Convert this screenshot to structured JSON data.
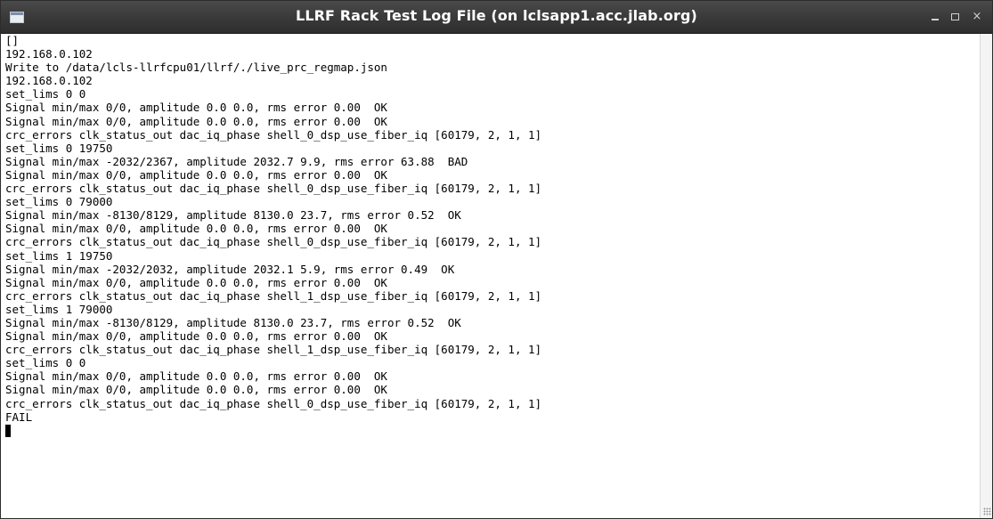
{
  "window": {
    "title": "LLRF Rack Test Log File (on lclsapp1.acc.jlab.org)",
    "icon": "terminal-icon",
    "controls": {
      "minimize": "minimize-icon",
      "maximize": "maximize-icon",
      "close_glyph": "×"
    },
    "colors": {
      "titlebar": "#3a3a3a",
      "title_text": "#ffffff",
      "terminal_bg": "#ffffff",
      "terminal_text": "#000000"
    }
  },
  "terminal": {
    "lines": [
      "[]",
      "192.168.0.102",
      "Write to /data/lcls-llrfcpu01/llrf/./live_prc_regmap.json",
      "192.168.0.102",
      "set_lims 0 0",
      "Signal min/max 0/0, amplitude 0.0 0.0, rms error 0.00  OK",
      "Signal min/max 0/0, amplitude 0.0 0.0, rms error 0.00  OK",
      "crc_errors clk_status_out dac_iq_phase shell_0_dsp_use_fiber_iq [60179, 2, 1, 1]",
      "set_lims 0 19750",
      "Signal min/max -2032/2367, amplitude 2032.7 9.9, rms error 63.88  BAD",
      "Signal min/max 0/0, amplitude 0.0 0.0, rms error 0.00  OK",
      "crc_errors clk_status_out dac_iq_phase shell_0_dsp_use_fiber_iq [60179, 2, 1, 1]",
      "set_lims 0 79000",
      "Signal min/max -8130/8129, amplitude 8130.0 23.7, rms error 0.52  OK",
      "Signal min/max 0/0, amplitude 0.0 0.0, rms error 0.00  OK",
      "crc_errors clk_status_out dac_iq_phase shell_0_dsp_use_fiber_iq [60179, 2, 1, 1]",
      "set_lims 1 19750",
      "Signal min/max -2032/2032, amplitude 2032.1 5.9, rms error 0.49  OK",
      "Signal min/max 0/0, amplitude 0.0 0.0, rms error 0.00  OK",
      "crc_errors clk_status_out dac_iq_phase shell_1_dsp_use_fiber_iq [60179, 2, 1, 1]",
      "set_lims 1 79000",
      "Signal min/max -8130/8129, amplitude 8130.0 23.7, rms error 0.52  OK",
      "Signal min/max 0/0, amplitude 0.0 0.0, rms error 0.00  OK",
      "crc_errors clk_status_out dac_iq_phase shell_1_dsp_use_fiber_iq [60179, 2, 1, 1]",
      "set_lims 0 0",
      "Signal min/max 0/0, amplitude 0.0 0.0, rms error 0.00  OK",
      "Signal min/max 0/0, amplitude 0.0 0.0, rms error 0.00  OK",
      "crc_errors clk_status_out dac_iq_phase shell_0_dsp_use_fiber_iq [60179, 2, 1, 1]",
      "FAIL"
    ]
  }
}
